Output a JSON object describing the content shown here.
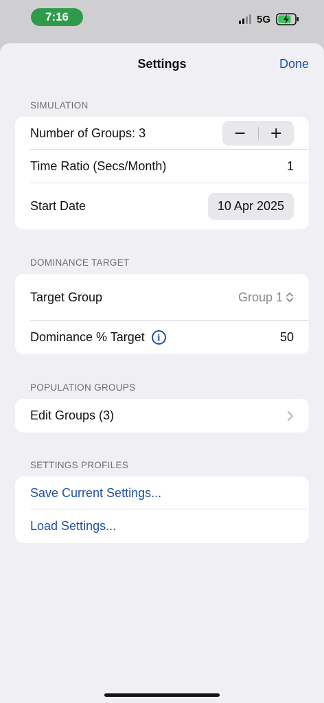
{
  "status_bar": {
    "time": "7:16",
    "network": "5G",
    "icons": [
      "signal-icon",
      "battery-charging-icon"
    ]
  },
  "nav": {
    "title": "Settings",
    "done_label": "Done"
  },
  "simulation": {
    "header": "SIMULATION",
    "groups_label": "Number of Groups: 3",
    "stepper_minus": "−",
    "stepper_plus": "+",
    "time_ratio_label": "Time Ratio (Secs/Month)",
    "time_ratio_value": "1",
    "start_date_label": "Start Date",
    "start_date_value": "10 Apr 2025"
  },
  "dominance": {
    "header": "DOMINANCE TARGET",
    "target_group_label": "Target Group",
    "target_group_value": "Group 1",
    "target_percent_label": "Dominance % Target",
    "target_percent_value": "50",
    "info_glyph": "i"
  },
  "population": {
    "header": "POPULATION GROUPS",
    "edit_label": "Edit Groups (3)"
  },
  "profiles": {
    "header": "SETTINGS PROFILES",
    "save_label": "Save Current Settings...",
    "load_label": "Load Settings..."
  },
  "colors": {
    "accent": "#1d4fa8",
    "time_pill": "#2e9a4a",
    "battery": "#34c759"
  }
}
